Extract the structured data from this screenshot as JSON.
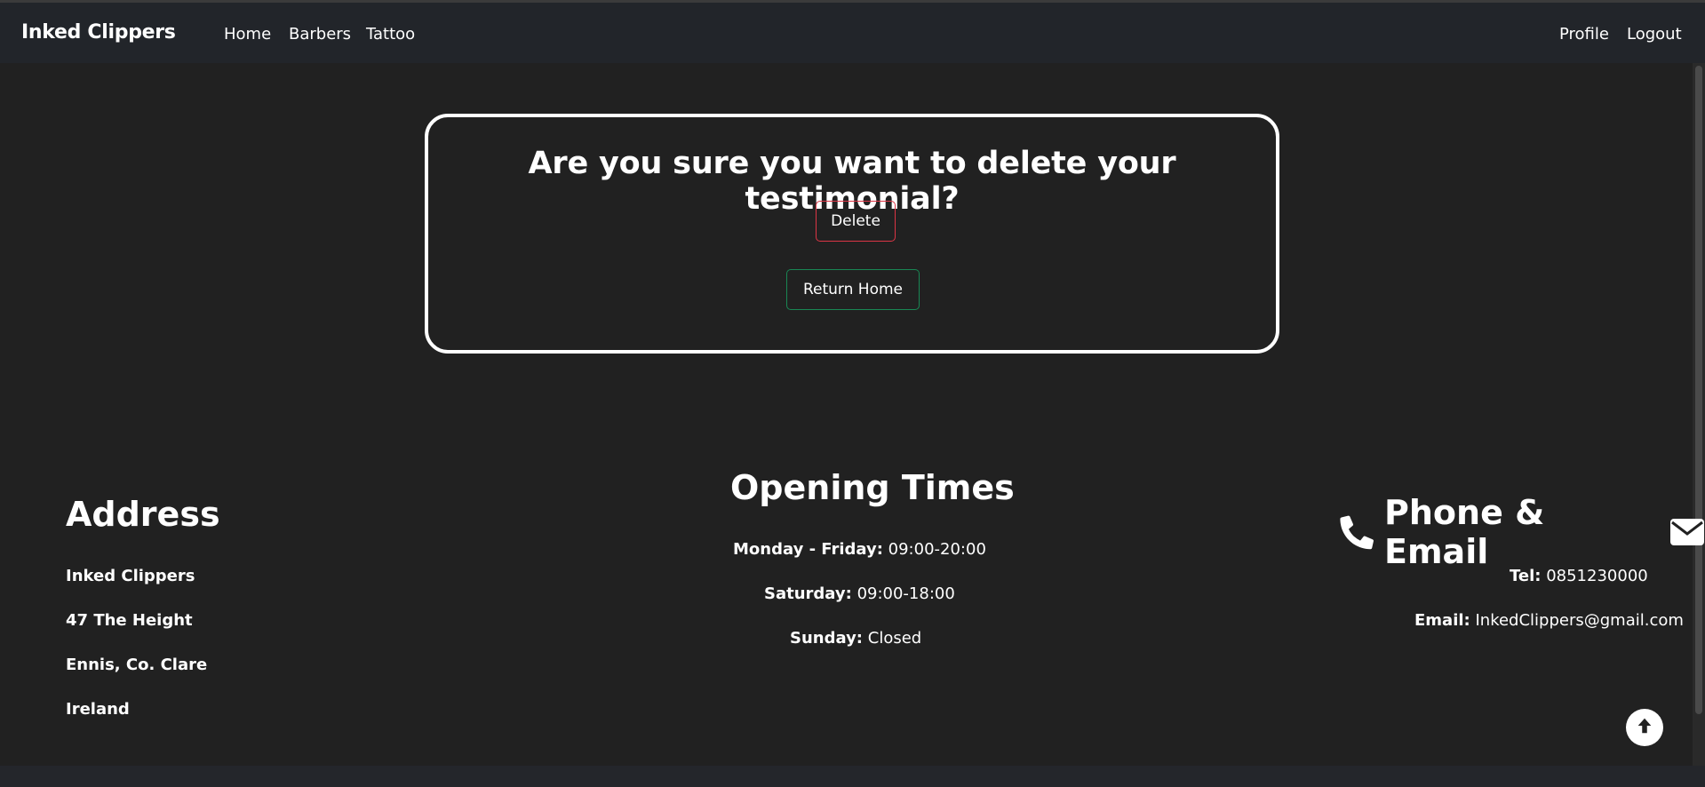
{
  "nav": {
    "brand": "Inked Clippers",
    "links": [
      "Home",
      "Barbers",
      "Tattoo"
    ],
    "right_links": [
      "Profile",
      "Logout"
    ]
  },
  "modal": {
    "title": "Are you sure you want to delete your testimonial?",
    "delete_label": "Delete",
    "return_label": "Return Home"
  },
  "footer": {
    "address": {
      "title": "Address",
      "lines": [
        "Inked Clippers",
        "47 The Height",
        "Ennis, Co. Clare",
        "Ireland"
      ]
    },
    "opening": {
      "title": "Opening Times",
      "rows": [
        {
          "day": "Monday - Friday:",
          "hours": "09:00-20:00"
        },
        {
          "day": "Saturday:",
          "hours": "09:00-18:00"
        },
        {
          "day": "Sunday:",
          "hours": "Closed"
        }
      ]
    },
    "contact": {
      "title": "Phone & Email",
      "tel_label": "Tel:",
      "tel_value": "0851230000",
      "email_label": "Email:",
      "email_value": "InkedClippers@gmail.com"
    }
  },
  "icons": {
    "phone": "phone-icon",
    "email": "envelope-icon",
    "scroll_top": "arrow-up-icon"
  },
  "colors": {
    "background": "#212121",
    "navbar": "#22252a",
    "delete_border": "#dc3545",
    "return_border": "#198754"
  }
}
